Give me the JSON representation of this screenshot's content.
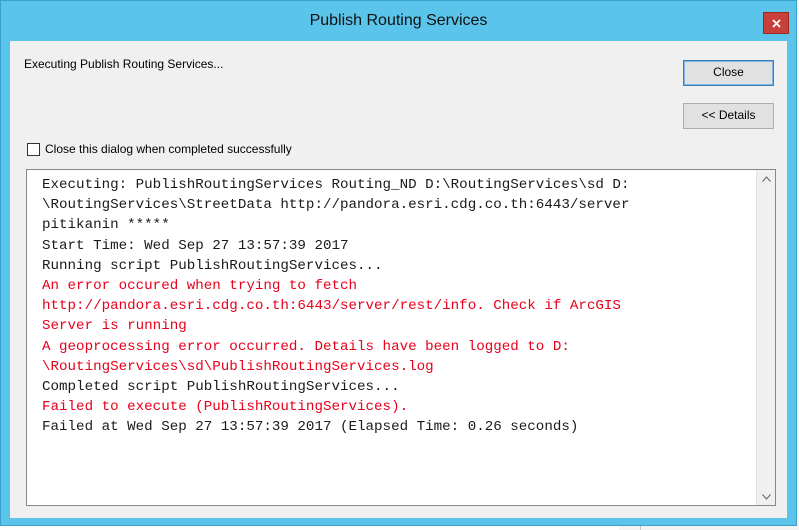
{
  "window": {
    "title": "Publish Routing Services"
  },
  "dialog": {
    "status_text": "Executing Publish Routing Services...",
    "close_button_label": "Close",
    "details_button_label": "<< Details",
    "auto_close_checkbox": {
      "label": "Close this dialog when completed successfully",
      "checked": false
    }
  },
  "log": {
    "lines": [
      {
        "text": "Executing: PublishRoutingServices Routing_ND D:\\RoutingServices\\sd D:",
        "type": "info"
      },
      {
        "text": "\\RoutingServices\\StreetData http://pandora.esri.cdg.co.th:6443/server",
        "type": "info"
      },
      {
        "text": "pitikanin *****",
        "type": "info"
      },
      {
        "text": "Start Time: Wed Sep 27 13:57:39 2017",
        "type": "info"
      },
      {
        "text": "Running script PublishRoutingServices...",
        "type": "info"
      },
      {
        "text": "An error occured when trying to fetch",
        "type": "error"
      },
      {
        "text": "http://pandora.esri.cdg.co.th:6443/server/rest/info. Check if ArcGIS",
        "type": "error"
      },
      {
        "text": "Server is running",
        "type": "error"
      },
      {
        "text": "A geoprocessing error occurred. Details have been logged to D:",
        "type": "error"
      },
      {
        "text": "\\RoutingServices\\sd\\PublishRoutingServices.log",
        "type": "error"
      },
      {
        "text": "Completed script PublishRoutingServices...",
        "type": "info"
      },
      {
        "text": "Failed to execute (PublishRoutingServices).",
        "type": "error"
      },
      {
        "text": "Failed at Wed Sep 27 13:57:39 2017 (Elapsed Time: 0.26 seconds)",
        "type": "info"
      }
    ]
  },
  "colors": {
    "title_bar": "#5bc4ea",
    "close_x": "#c7413a",
    "error_text": "#e8001c",
    "info_text": "#1a1a1a"
  }
}
